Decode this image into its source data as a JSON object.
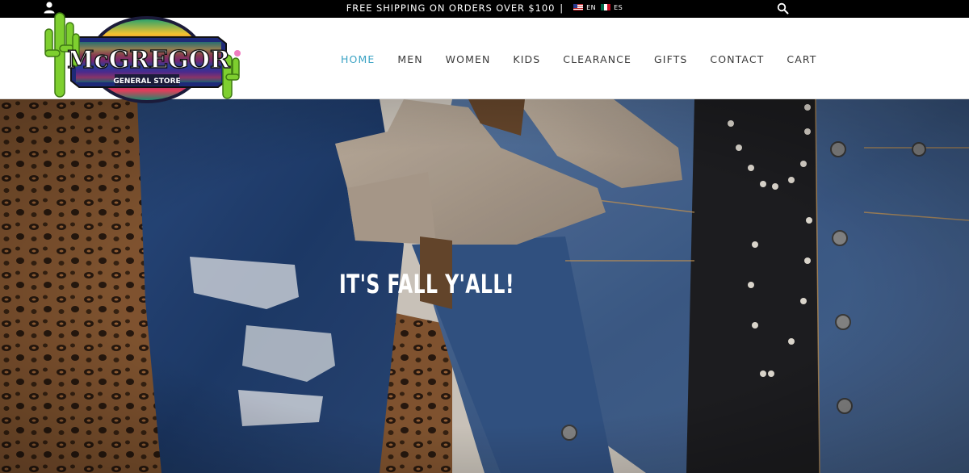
{
  "topbar": {
    "promo_text": "FREE SHIPPING ON ORDERS OVER $100",
    "separator": "|",
    "languages": [
      {
        "code": "EN",
        "flag": "us-flag-icon"
      },
      {
        "code": "ES",
        "flag": "mx-flag-icon"
      }
    ],
    "account_icon": "user-icon",
    "search_icon": "search-icon"
  },
  "logo": {
    "brand_main": "McGREGOR",
    "brand_sub": "GENERAL STORE"
  },
  "nav": {
    "items": [
      "HOME",
      "MEN",
      "WOMEN",
      "KIDS",
      "CLEARANCE",
      "GIFTS",
      "CONTACT",
      "CART"
    ],
    "active_index": 0
  },
  "hero": {
    "title": "IT'S FALL Y'ALL!"
  },
  "colors": {
    "topbar_bg": "#000000",
    "nav_active": "#3ba3c4",
    "nav_text": "#3a3a3a"
  }
}
